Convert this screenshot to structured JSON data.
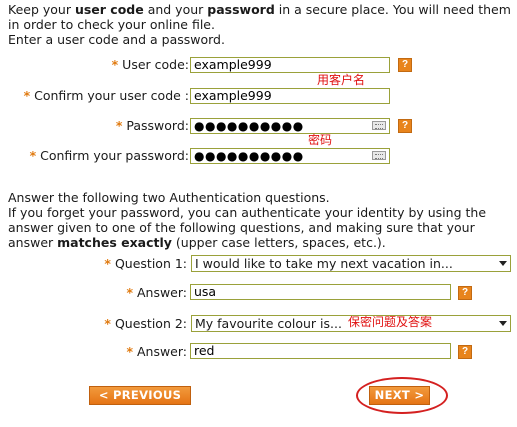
{
  "intro": {
    "line1_a": "Keep your ",
    "line1_b": "user code",
    "line1_c": " and your ",
    "line1_d": "password",
    "line1_e": " in a secure place. You will need them",
    "line2": "in order to check your online file.",
    "line3": "Enter a user code and a password."
  },
  "form": {
    "user_code_label": "User code:",
    "user_code_value": "example999",
    "confirm_user_code_label": "Confirm your user code :",
    "confirm_user_code_value": "example999",
    "password_label": "Password:",
    "password_value": "●●●●●●●●●●",
    "confirm_password_label": "Confirm your password:",
    "confirm_password_value": "●●●●●●●●●●",
    "required_marker": "*",
    "help_glyph": "?"
  },
  "auth": {
    "line1": "Answer the following two Authentication questions.",
    "line2": "If you forget your password, you can authenticate your identity by using the",
    "line3": "answer given to one of the following questions, and making sure that your",
    "line4_a": "answer ",
    "line4_b": "matches exactly",
    "line4_c": " (upper case letters, spaces, etc.).",
    "question1_label": "Question 1:",
    "question1_value": "I would like to take my next vacation in...",
    "answer1_label": "Answer:",
    "answer1_value": "usa",
    "question2_label": "Question 2:",
    "question2_value": "My favourite colour is...",
    "answer2_label": "Answer:",
    "answer2_value": "red"
  },
  "annotations": {
    "username": "用客户名",
    "password": "密码",
    "security_qa": "保密问题及答案"
  },
  "buttons": {
    "previous": "< PREVIOUS",
    "next": "NEXT >"
  },
  "colors": {
    "accent_orange": "#e8841c",
    "field_border": "#9aa13a",
    "annotation_red": "#e01010"
  }
}
